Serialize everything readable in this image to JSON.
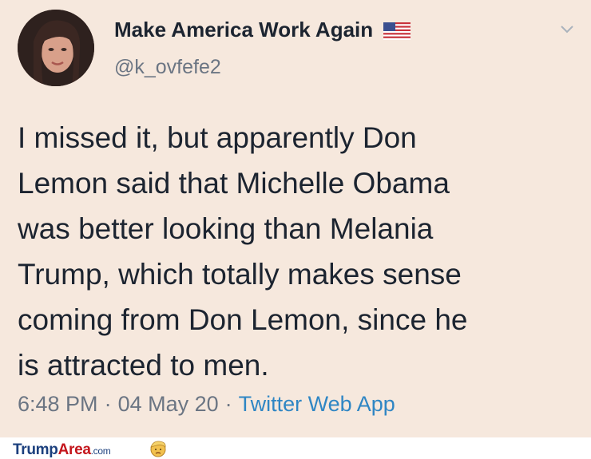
{
  "tweet": {
    "display_name": "Make America Work Again",
    "handle": "@k_ovfefe2",
    "flag_icon": "us-flag-icon",
    "text_lines": [
      "I missed it, but apparently Don",
      "Lemon said that Michelle Obama",
      "was better looking than Melania",
      "Trump, which totally makes sense",
      "coming from Don Lemon, since he",
      "is attracted to men."
    ],
    "time": "6:48 PM",
    "date": "04 May 20",
    "separator": "·",
    "source": "Twitter Web App",
    "menu_icon": "chevron-down-icon"
  },
  "footer": {
    "brand_part1": "Trump",
    "brand_part2": "Area",
    "brand_part3": ".com",
    "brand_icon": "trump-face-icon"
  },
  "colors": {
    "background": "#f6e8dd",
    "text": "#1c2430",
    "secondary": "#6b7583",
    "link": "#2f86c4",
    "brand_blue": "#1b3f7d",
    "brand_red": "#c4161c"
  }
}
